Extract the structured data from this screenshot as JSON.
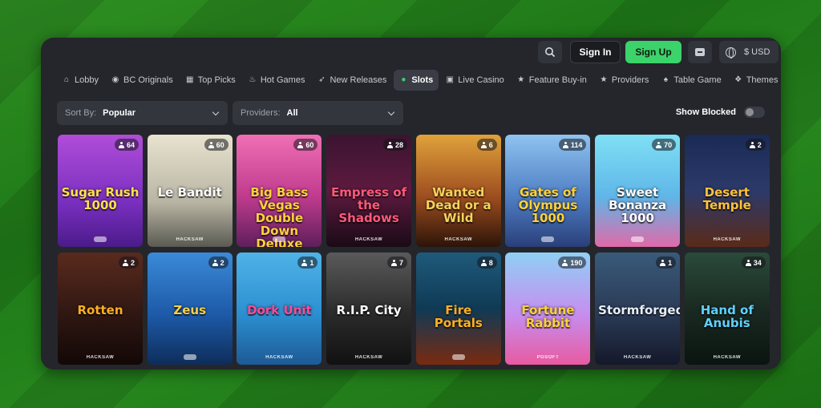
{
  "header": {
    "sign_in": "Sign In",
    "sign_up": "Sign Up",
    "currency": "$ USD"
  },
  "nav": [
    {
      "label": "Lobby",
      "icon": "home-icon"
    },
    {
      "label": "BC Originals",
      "icon": "originals-icon"
    },
    {
      "label": "Top Picks",
      "icon": "grid-icon"
    },
    {
      "label": "Hot Games",
      "icon": "flame-icon"
    },
    {
      "label": "New Releases",
      "icon": "rocket-icon"
    },
    {
      "label": "Slots",
      "icon": "slots-icon",
      "active": true
    },
    {
      "label": "Live Casino",
      "icon": "live-icon"
    },
    {
      "label": "Feature Buy-in",
      "icon": "star-icon"
    },
    {
      "label": "Providers",
      "icon": "star-icon"
    },
    {
      "label": "Table Game",
      "icon": "table-icon"
    },
    {
      "label": "Themes",
      "icon": "themes-icon"
    }
  ],
  "filters": {
    "sort_label": "Sort By:",
    "sort_value": "Popular",
    "providers_label": "Providers:",
    "providers_value": "All",
    "show_blocked": "Show Blocked"
  },
  "games": [
    {
      "title": "Sugar Rush 1000",
      "players": "64",
      "provider": "",
      "bg": "linear-gradient(180deg,#b04dd8,#7a2fc0 60%,#4b1b8a)",
      "title_color": "#ffe14a"
    },
    {
      "title": "Le Bandit",
      "players": "60",
      "provider": "HACKSAW",
      "bg": "linear-gradient(180deg,#e8e3cf,#b9b5a4 60%,#5a5a52)",
      "title_color": "#ffffff"
    },
    {
      "title": "Big Bass Vegas Double Down Deluxe",
      "players": "60",
      "provider": "",
      "bg": "linear-gradient(180deg,#f06fb4,#c03b8e 55%,#5e1f5c)",
      "title_color": "#ffd23a"
    },
    {
      "title": "Empress of the Shadows",
      "players": "28",
      "provider": "HACKSAW",
      "bg": "linear-gradient(180deg,#3b1430,#5d1a3f 50%,#1a0a16)",
      "title_color": "#ff5a7a"
    },
    {
      "title": "Wanted Dead or a Wild",
      "players": "6",
      "provider": "HACKSAW",
      "bg": "linear-gradient(180deg,#e0a23a,#9e4e20 55%,#2c1408)",
      "title_color": "#f6d35a"
    },
    {
      "title": "Gates of Olympus 1000",
      "players": "114",
      "provider": "",
      "bg": "linear-gradient(180deg,#8fc3f0,#4f7fc4 55%,#2a3f7a)",
      "title_color": "#ffd23a"
    },
    {
      "title": "Sweet Bonanza 1000",
      "players": "70",
      "provider": "",
      "bg": "linear-gradient(180deg,#7fe0f5,#5fb6e8 55%,#e06aa8)",
      "title_color": "#ffffff"
    },
    {
      "title": "Desert Temple",
      "players": "2",
      "provider": "HACKSAW",
      "bg": "linear-gradient(180deg,#1a2a55,#2c3a6a 50%,#5a2a18)",
      "title_color": "#ffc23a"
    },
    {
      "title": "Rotten",
      "players": "2",
      "provider": "HACKSAW",
      "bg": "linear-gradient(180deg,#5a2a1e,#2f1712 55%,#120806)",
      "title_color": "#ffb020"
    },
    {
      "title": "Zeus",
      "players": "2",
      "provider": "",
      "bg": "linear-gradient(180deg,#3a8ad8,#1d5aa8 55%,#0e2d5a)",
      "title_color": "#f5d14a"
    },
    {
      "title": "Dork Unit",
      "players": "1",
      "provider": "HACKSAW",
      "bg": "linear-gradient(180deg,#4fb3e8,#2c8fd0 55%,#1d5a95)",
      "title_color": "#ff4a9a"
    },
    {
      "title": "R.I.P. City",
      "players": "7",
      "provider": "HACKSAW",
      "bg": "linear-gradient(180deg,#5a5a5a,#2a2a2a 55%,#111)",
      "title_color": "#ffffff"
    },
    {
      "title": "Fire Portals",
      "players": "8",
      "provider": "",
      "bg": "linear-gradient(180deg,#1f5a7a,#0f3a55 50%,#7a2a10)",
      "title_color": "#ffb020"
    },
    {
      "title": "Fortune Rabbit",
      "players": "190",
      "provider": "PGSOFT",
      "bg": "linear-gradient(180deg,#8fd0f5,#c68ef0 55%,#e85aa0)",
      "title_color": "#ffd23a"
    },
    {
      "title": "Stormforged",
      "players": "1",
      "provider": "HACKSAW",
      "bg": "linear-gradient(180deg,#3a5a7a,#2a3a55 55%,#14182a)",
      "title_color": "#e6eef8"
    },
    {
      "title": "Hand of Anubis",
      "players": "34",
      "provider": "HACKSAW",
      "bg": "linear-gradient(180deg,#2a4a3a,#1a2a22 50%,#0a1410)",
      "title_color": "#5fd0ff"
    }
  ]
}
